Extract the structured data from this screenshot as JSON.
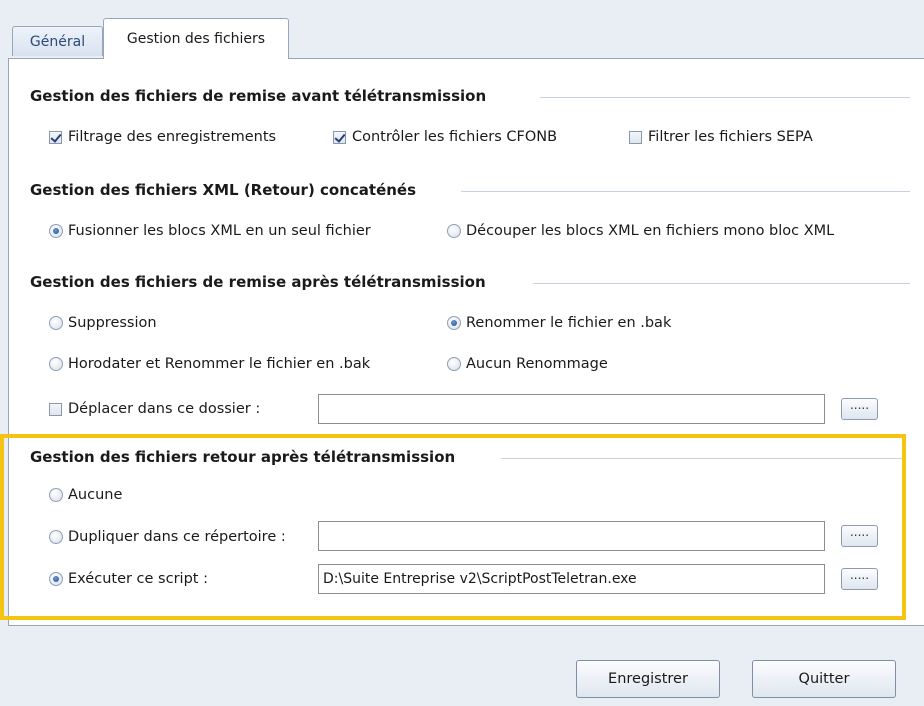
{
  "tabs": [
    {
      "label": "Général"
    },
    {
      "label": "Gestion des fichiers"
    }
  ],
  "section_avant": {
    "title": "Gestion des fichiers de remise avant télétransmission",
    "options": [
      {
        "label": "Filtrage des enregistrements",
        "checked": true
      },
      {
        "label": "Contrôler les fichiers CFONB",
        "checked": true
      },
      {
        "label": "Filtrer les fichiers SEPA",
        "checked": false
      }
    ]
  },
  "section_xml": {
    "title": "Gestion des fichiers XML (Retour) concaténés",
    "options": [
      {
        "label": "Fusionner les blocs XML en un seul fichier",
        "selected": true
      },
      {
        "label": "Découper les blocs XML en fichiers mono bloc XML",
        "selected": false
      }
    ]
  },
  "section_apres": {
    "title": "Gestion des fichiers de remise après télétransmission",
    "options": [
      {
        "label": "Suppression",
        "selected": false
      },
      {
        "label": "Renommer le fichier en .bak",
        "selected": true
      },
      {
        "label": "Horodater et Renommer le fichier en .bak",
        "selected": false
      },
      {
        "label": "Aucun Renommage",
        "selected": false
      }
    ],
    "move_label": "Déplacer dans ce dossier :",
    "move_checked": false,
    "move_path": "",
    "browse_label": "....."
  },
  "section_retour": {
    "title": "Gestion des fichiers retour après télétransmission",
    "options": [
      {
        "label": "Aucune",
        "selected": false
      },
      {
        "label": "Dupliquer dans ce répertoire :",
        "selected": false
      },
      {
        "label": "Exécuter ce script :",
        "selected": true
      }
    ],
    "duplicate_path": "",
    "script_path": "D:\\Suite Entreprise v2\\ScriptPostTeletran.exe",
    "browse_label": "....."
  },
  "buttons": {
    "save": "Enregistrer",
    "quit": "Quitter"
  },
  "colors": {
    "highlight": "#f5c311",
    "background": "#e9eef5"
  }
}
